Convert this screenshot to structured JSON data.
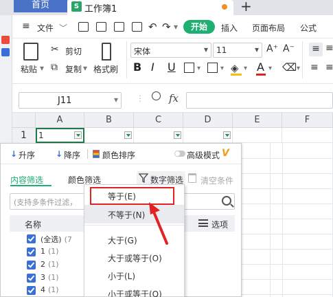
{
  "titlebar": {
    "home_tab": "首页",
    "doc_icon": "S",
    "doc_name": "工作簿1",
    "new_tab": "+"
  },
  "menubar": {
    "file": "文件",
    "start": "开始",
    "insert": "插入",
    "page_layout": "页面布局",
    "formula": "公式"
  },
  "ribbon": {
    "paste": "粘贴",
    "cut": "剪切",
    "copy": "复制",
    "format_painter": "格式刷",
    "font_name": "宋体",
    "font_size": "11",
    "grow_font": "A⁺",
    "shrink_font": "A⁻",
    "bold": "B",
    "italic": "I",
    "underline": "U",
    "font_color_letter": "A"
  },
  "formulabar": {
    "cell_ref": "J11",
    "fx": "fx"
  },
  "grid": {
    "columns": [
      "A",
      "B",
      "C",
      "D",
      "E",
      "F"
    ],
    "row_number": "1",
    "cell_a1": "1"
  },
  "filter_panel": {
    "sort_asc": "升序",
    "sort_desc": "降序",
    "sort_color": "颜色排序",
    "advanced_mode": "高级模式",
    "vip": "V",
    "tab_content": "内容筛选",
    "tab_color": "颜色筛选",
    "tab_number": "数字筛选",
    "clear": "清空条件",
    "search_placeholder": "(支持多条件过滤，",
    "list_header": "名称",
    "options": "选项",
    "items": [
      {
        "label": "(全选)",
        "count": "(7"
      },
      {
        "label": "1",
        "count": "(1)"
      },
      {
        "label": "2",
        "count": "(1)"
      },
      {
        "label": "3",
        "count": "(1)"
      },
      {
        "label": "4",
        "count": "(1)"
      }
    ]
  },
  "dropdown": {
    "items": [
      "等于(E)",
      "不等于(N)",
      "大于(G)",
      "大于或等于(O)",
      "小于(L)",
      "小于或等于(Q)"
    ]
  },
  "colors": {
    "accent_green": "#1eb072",
    "highlight_red": "#e02222",
    "checkbox_blue": "#3a6fd8"
  }
}
